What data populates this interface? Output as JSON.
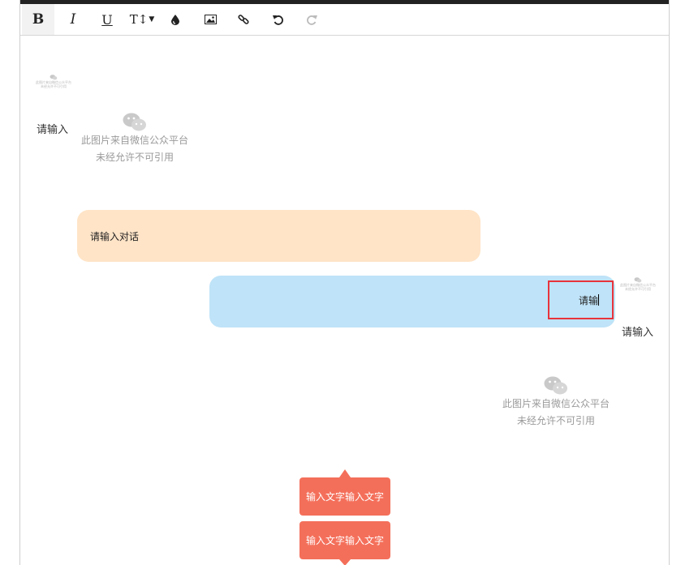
{
  "toolbar": {
    "bold_label": "B",
    "italic_label": "I",
    "underline_label": "U",
    "font_size_label": "T↕",
    "buttons": [
      {
        "name": "bold",
        "icon": "bold-icon"
      },
      {
        "name": "italic",
        "icon": "italic-icon"
      },
      {
        "name": "underline",
        "icon": "underline-icon"
      },
      {
        "name": "font-size",
        "icon": "font-size-icon"
      },
      {
        "name": "text-color",
        "icon": "ink-drop-icon"
      },
      {
        "name": "insert-image",
        "icon": "image-icon"
      },
      {
        "name": "insert-link",
        "icon": "link-icon"
      },
      {
        "name": "undo",
        "icon": "undo-icon"
      },
      {
        "name": "redo",
        "icon": "redo-icon",
        "disabled": true
      }
    ]
  },
  "content": {
    "avatar_left_caption": "请输入",
    "avatar_right_caption": "请输入",
    "placeholder_caption_line1": "此图片来自微信公众平台",
    "placeholder_caption_line2": "未经允许不可引用",
    "bubble_left_text": "请输入对话",
    "bubble_right_text": "请输",
    "tag_top_text": "输入文字输入文字",
    "tag_bottom_text": "输入文字输入文字"
  },
  "colors": {
    "bubble_left": "#ffe4c7",
    "bubble_right": "#bfe3f8",
    "tag": "#f46f5a",
    "edit_highlight": "#e8333b",
    "top_bar": "#222222"
  }
}
